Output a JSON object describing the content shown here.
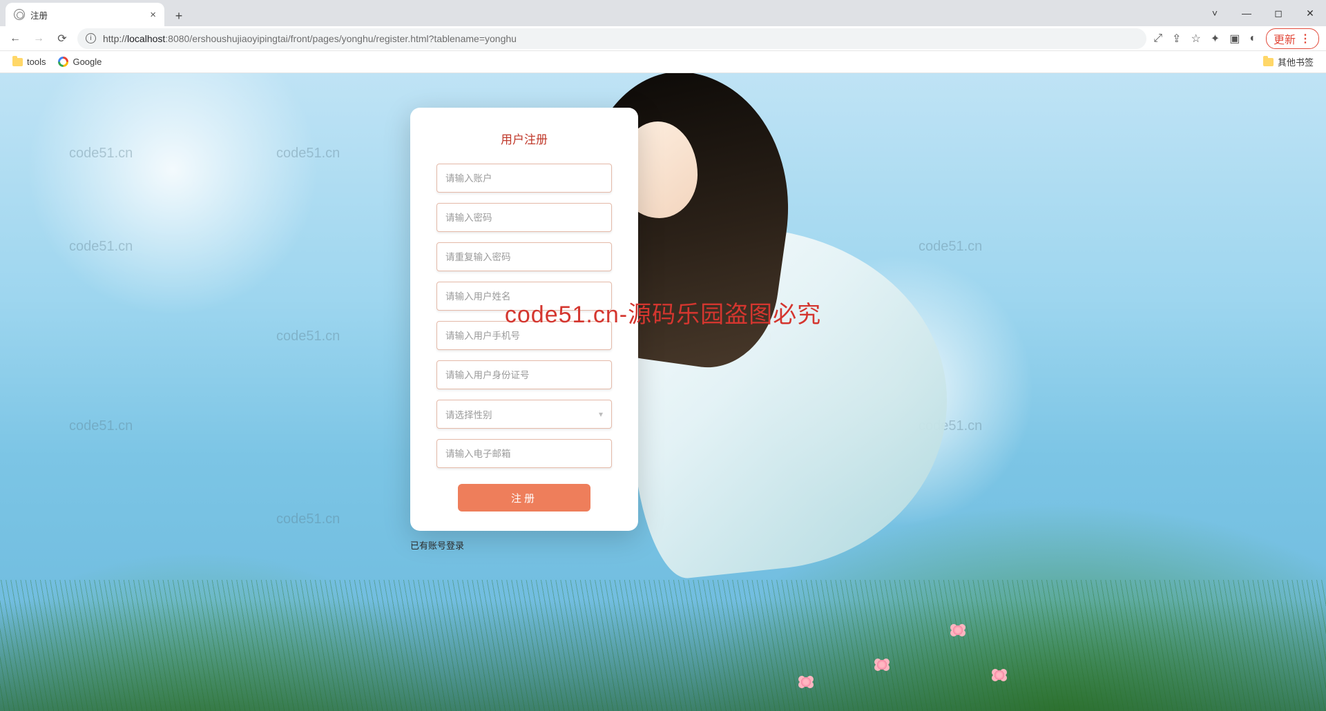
{
  "browser": {
    "tab_title": "注册",
    "url_host": "localhost",
    "url_port_path": ":8080/ershoushujiaoyipingtai/front/pages/yonghu/register.html?tablename=yonghu",
    "url_scheme": "http://",
    "update_label": "更新",
    "bookmarks": {
      "tools": "tools",
      "google": "Google",
      "other": "其他书签"
    }
  },
  "watermark": "code51.cn",
  "overlay": "code51.cn-源码乐园盗图必究",
  "form": {
    "title": "用户注册",
    "account_ph": "请输入账户",
    "password_ph": "请输入密码",
    "password2_ph": "请重复输入密码",
    "name_ph": "请输入用户姓名",
    "phone_ph": "请输入用户手机号",
    "idcard_ph": "请输入用户身份证号",
    "gender_ph": "请选择性别",
    "email_ph": "请输入电子邮箱",
    "submit": "注册",
    "login_link": "已有账号登录"
  }
}
